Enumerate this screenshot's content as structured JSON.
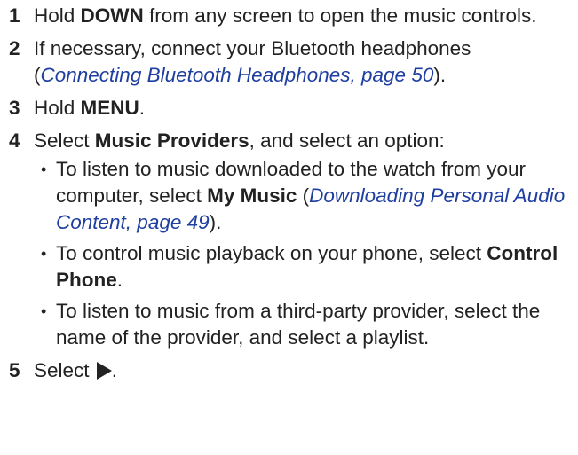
{
  "steps": [
    {
      "number": "1",
      "t1": "Hold ",
      "b1": "DOWN",
      "t2": " from any screen to open the music controls."
    },
    {
      "number": "2",
      "t1": "If necessary, connect your Bluetooth headphones (",
      "link": "Connecting Bluetooth Headphones, page 50",
      "t2": ")."
    },
    {
      "number": "3",
      "t1": "Hold ",
      "b1": "MENU",
      "t2": "."
    },
    {
      "number": "4",
      "t1": "Select ",
      "b1": "Music Providers",
      "t2": ", and select an option:",
      "options": [
        {
          "bullet": "•",
          "t1": "To listen to music downloaded to the watch from your computer, select ",
          "b1": "My Music",
          "t2": " (",
          "link": "Downloading Personal Audio Content, page 49",
          "t3": ")."
        },
        {
          "bullet": "•",
          "t1": "To control music playback on your phone, select ",
          "b1": "Control Phone",
          "t2": "."
        },
        {
          "bullet": "•",
          "t1": "To listen to music from a third-party provider, select the name of the provider, and select a playlist."
        }
      ]
    },
    {
      "number": "5",
      "t1": "Select ",
      "icon": "play-icon",
      "t2": "."
    }
  ]
}
